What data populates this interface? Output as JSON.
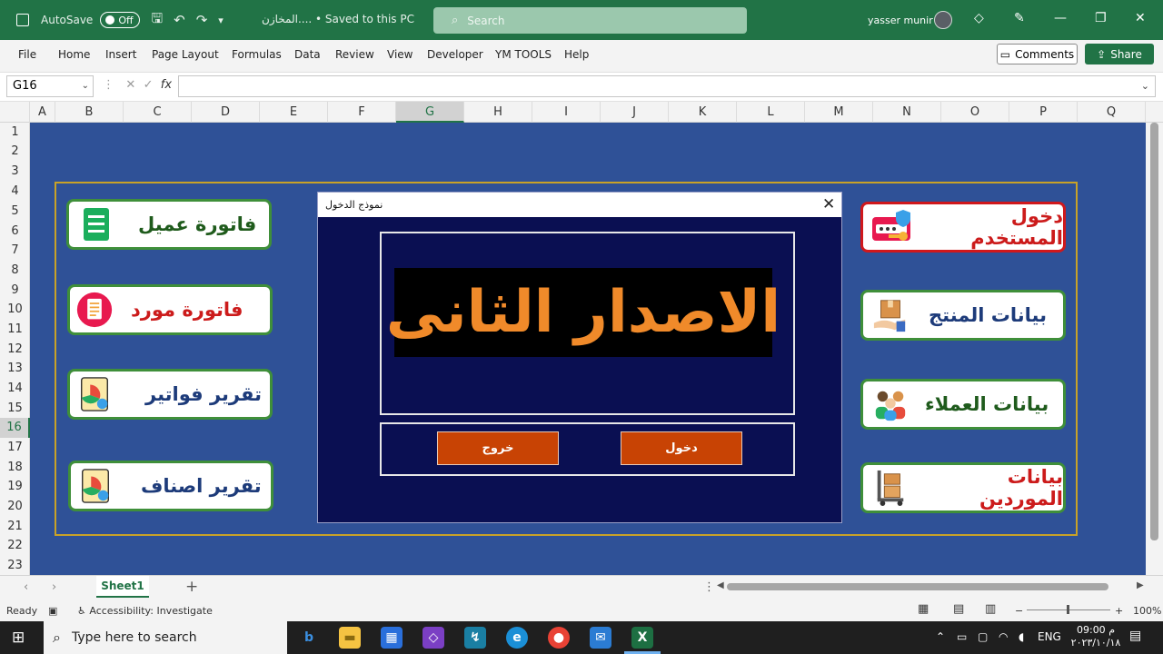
{
  "titlebar": {
    "autosave_label": "AutoSave",
    "autosave_state": "Off",
    "doc_title": "المخازن.... • Saved to this PC",
    "search_placeholder": "Search",
    "user_name": "yasser munir"
  },
  "ribbon": {
    "tabs": [
      "File",
      "Home",
      "Insert",
      "Page Layout",
      "Formulas",
      "Data",
      "Review",
      "View",
      "Developer",
      "YM TOOLS",
      "Help"
    ],
    "comments_label": "Comments",
    "share_label": "Share"
  },
  "formula_bar": {
    "name_box": "G16",
    "fx_label": "fx",
    "value": ""
  },
  "grid": {
    "columns": [
      "A",
      "B",
      "C",
      "D",
      "E",
      "F",
      "G",
      "H",
      "I",
      "J",
      "K",
      "L",
      "M",
      "N",
      "O",
      "P",
      "Q"
    ],
    "rows": [
      "1",
      "2",
      "3",
      "4",
      "5",
      "6",
      "7",
      "8",
      "9",
      "10",
      "11",
      "12",
      "13",
      "14",
      "15",
      "16",
      "17",
      "18",
      "19",
      "20",
      "21",
      "22",
      "23"
    ],
    "selected_column": "G",
    "selected_row": "16"
  },
  "dashboard": {
    "left_cards": [
      {
        "label": "فاتورة عميل",
        "icon": "invoice-icon",
        "color": "#1f5b1c"
      },
      {
        "label": "فاتورة مورد",
        "icon": "supplier-invoice-icon",
        "color": "#cc1b1b"
      },
      {
        "label": "تقرير فواتير",
        "icon": "report-chart-icon",
        "color": "#1d3b7a"
      },
      {
        "label": "تقرير اصناف",
        "icon": "report-chart-icon",
        "color": "#1d3b7a"
      }
    ],
    "right_cards": [
      {
        "label": "دخول المستخدم",
        "icon": "login-key-icon",
        "color": "#cc1b1b"
      },
      {
        "label": "بيانات المنتج",
        "icon": "product-box-icon",
        "color": "#1d3b7a"
      },
      {
        "label": "بيانات العملاء",
        "icon": "customers-icon",
        "color": "#1f5b1c"
      },
      {
        "label": "بيانات الموردين",
        "icon": "supplier-cart-icon",
        "color": "#cc1b1b"
      }
    ]
  },
  "dialog": {
    "title": "نموذج الدخول",
    "banner_text": "الاصدار الثانى",
    "exit_label": "خروج",
    "login_label": "دخول"
  },
  "sheet_tabs": {
    "active": "Sheet1"
  },
  "statusbar": {
    "ready": "Ready",
    "accessibility": "Accessibility: Investigate",
    "zoom": "100%"
  },
  "taskbar": {
    "search_placeholder": "Type here to search",
    "lang": "ENG",
    "time": "09:00 م",
    "date": "٢٠٢٣/١٠/١٨"
  }
}
